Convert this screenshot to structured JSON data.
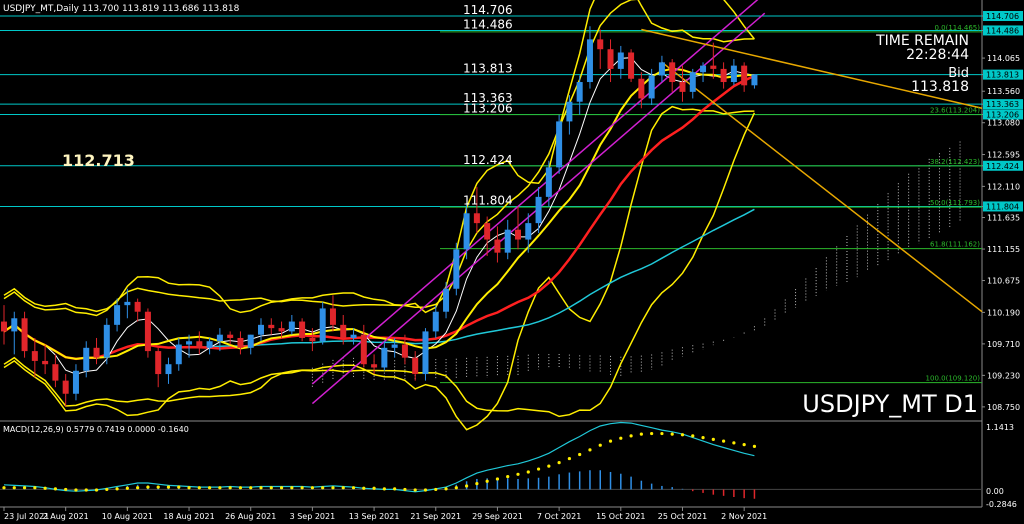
{
  "header": {
    "info": "USDJPY_MT,Daily  113.700 113.819 113.686 113.818"
  },
  "timer": {
    "title": "TIME REMAIN",
    "value": "22:28:44",
    "bid_label": "Bid",
    "bid_value": "113.818"
  },
  "watermark": "USDJPY_MT D1",
  "left_label": "112.713",
  "macd": {
    "label": "MACD(12,26,9) 0.5779 0.7419 0.0000 -0.1640",
    "scale": [
      "1.1413",
      "0.00",
      "-0.2846"
    ]
  },
  "colors": {
    "background": "#000000",
    "bull": "#2f8fe6",
    "bear": "#e0262b",
    "level": "#00c8c8",
    "fib": "#2bb82b",
    "ma_red": "#ff2020",
    "ma_yellow": "#ffee00",
    "ma_cyan": "#20c8d8",
    "channel": "#d020d0",
    "trend": "#e8a800"
  },
  "chart_data": {
    "type": "candlestick",
    "symbol": "USDJPY_MT",
    "timeframe": "D1",
    "y_range": [
      108.55,
      114.95
    ],
    "grid": false,
    "x_ticks": [
      {
        "index": 0,
        "label": "23 Jul 2021"
      },
      {
        "index": 6,
        "label": "2 Aug 2021"
      },
      {
        "index": 12,
        "label": "10 Aug 2021"
      },
      {
        "index": 18,
        "label": "18 Aug 2021"
      },
      {
        "index": 24,
        "label": "26 Aug 2021"
      },
      {
        "index": 30,
        "label": "3 Sep 2021"
      },
      {
        "index": 36,
        "label": "13 Sep 2021"
      },
      {
        "index": 42,
        "label": "21 Sep 2021"
      },
      {
        "index": 48,
        "label": "29 Sep 2021"
      },
      {
        "index": 54,
        "label": "7 Oct 2021"
      },
      {
        "index": 60,
        "label": "15 Oct 2021"
      },
      {
        "index": 66,
        "label": "25 Oct 2021"
      },
      {
        "index": 72,
        "label": "2 Nov 2021"
      }
    ],
    "y_ticks": [
      "114.706",
      "114.486",
      "114.065",
      "113.813",
      "113.560",
      "113.363",
      "113.206",
      "113.080",
      "112.595",
      "112.424",
      "112.110",
      "111.804",
      "111.635",
      "111.155",
      "110.675",
      "110.190",
      "109.710",
      "109.230",
      "108.750"
    ],
    "price_highlights": [
      {
        "value": 114.706,
        "label": "114.706"
      },
      {
        "value": 114.486,
        "label": "114.486"
      },
      {
        "value": 113.813,
        "label": "113.813"
      },
      {
        "value": 113.363,
        "label": "113.363"
      },
      {
        "value": 113.206,
        "label": "113.206"
      },
      {
        "value": 112.424,
        "label": "112.424"
      },
      {
        "value": 111.804,
        "label": "111.804"
      }
    ],
    "horizontal_levels": [
      {
        "value": 114.706,
        "label": "114.706"
      },
      {
        "value": 114.486,
        "label": "114.486"
      },
      {
        "value": 113.813,
        "label": "113.813"
      },
      {
        "value": 113.363,
        "label": "113.363"
      },
      {
        "value": 113.206,
        "label": "113.206"
      },
      {
        "value": 112.424,
        "label": "112.424"
      },
      {
        "value": 111.804,
        "label": "111.804"
      }
    ],
    "fib_levels": [
      {
        "value": 114.465,
        "label": "0.0(114.465)"
      },
      {
        "value": 113.204,
        "label": "23.6(113.204)"
      },
      {
        "value": 112.423,
        "label": "38.2(112.423)"
      },
      {
        "value": 111.793,
        "label": "50.0(111.793)"
      },
      {
        "value": 111.162,
        "label": "61.8(111.162)"
      },
      {
        "value": 109.12,
        "label": "100.0(109.120)"
      }
    ],
    "candles": [
      [
        110.05,
        110.3,
        109.7,
        109.9
      ],
      [
        109.9,
        110.2,
        109.55,
        110.1
      ],
      [
        110.1,
        110.2,
        109.5,
        109.6
      ],
      [
        109.6,
        109.8,
        109.2,
        109.45
      ],
      [
        109.45,
        109.7,
        109.25,
        109.4
      ],
      [
        109.4,
        109.55,
        109.05,
        109.15
      ],
      [
        109.15,
        109.25,
        108.75,
        108.95
      ],
      [
        108.95,
        109.4,
        108.85,
        109.3
      ],
      [
        109.3,
        109.75,
        109.2,
        109.65
      ],
      [
        109.65,
        109.8,
        109.4,
        109.5
      ],
      [
        109.5,
        110.1,
        109.4,
        110.0
      ],
      [
        110.0,
        110.4,
        109.9,
        110.3
      ],
      [
        110.3,
        110.55,
        110.1,
        110.35
      ],
      [
        110.35,
        110.4,
        110.05,
        110.2
      ],
      [
        110.2,
        110.25,
        109.5,
        109.6
      ],
      [
        109.6,
        109.65,
        109.05,
        109.25
      ],
      [
        109.25,
        109.5,
        109.1,
        109.4
      ],
      [
        109.4,
        109.8,
        109.3,
        109.7
      ],
      [
        109.7,
        109.85,
        109.5,
        109.75
      ],
      [
        109.75,
        109.9,
        109.55,
        109.65
      ],
      [
        109.65,
        109.8,
        109.55,
        109.75
      ],
      [
        109.75,
        109.95,
        109.6,
        109.85
      ],
      [
        109.85,
        109.9,
        109.7,
        109.8
      ],
      [
        109.8,
        109.9,
        109.55,
        109.65
      ],
      [
        109.65,
        109.85,
        109.55,
        109.85
      ],
      [
        109.85,
        110.1,
        109.75,
        110.0
      ],
      [
        110.0,
        110.1,
        109.85,
        109.95
      ],
      [
        109.95,
        110.05,
        109.8,
        109.9
      ],
      [
        109.9,
        110.15,
        109.85,
        110.05
      ],
      [
        110.05,
        110.1,
        109.75,
        109.8
      ],
      [
        109.8,
        109.95,
        109.6,
        109.75
      ],
      [
        109.75,
        110.35,
        109.7,
        110.25
      ],
      [
        110.25,
        110.45,
        109.9,
        110.0
      ],
      [
        110.0,
        110.15,
        109.7,
        109.8
      ],
      [
        109.8,
        109.95,
        109.7,
        109.85
      ],
      [
        109.85,
        110.0,
        109.35,
        109.4
      ],
      [
        109.4,
        109.55,
        109.25,
        109.35
      ],
      [
        109.35,
        109.75,
        109.3,
        109.65
      ],
      [
        109.65,
        109.8,
        109.5,
        109.7
      ],
      [
        109.7,
        109.85,
        109.4,
        109.5
      ],
      [
        109.5,
        109.6,
        109.15,
        109.25
      ],
      [
        109.25,
        109.95,
        109.15,
        109.9
      ],
      [
        109.9,
        110.3,
        109.8,
        110.2
      ],
      [
        110.2,
        110.65,
        110.1,
        110.55
      ],
      [
        110.55,
        111.25,
        110.45,
        111.15
      ],
      [
        111.15,
        111.85,
        111.0,
        111.7
      ],
      [
        111.7,
        112.1,
        111.4,
        111.55
      ],
      [
        111.55,
        111.65,
        111.05,
        111.3
      ],
      [
        111.3,
        111.5,
        110.95,
        111.1
      ],
      [
        111.1,
        111.6,
        111.0,
        111.45
      ],
      [
        111.45,
        111.8,
        111.15,
        111.3
      ],
      [
        111.3,
        111.7,
        111.1,
        111.55
      ],
      [
        111.55,
        112.1,
        111.4,
        111.95
      ],
      [
        111.95,
        112.5,
        111.8,
        112.4
      ],
      [
        112.4,
        113.2,
        112.3,
        113.1
      ],
      [
        113.1,
        113.5,
        112.9,
        113.4
      ],
      [
        113.4,
        113.8,
        113.2,
        113.7
      ],
      [
        113.7,
        114.55,
        113.6,
        114.35
      ],
      [
        114.35,
        114.5,
        113.9,
        114.2
      ],
      [
        114.2,
        114.35,
        113.7,
        113.9
      ],
      [
        113.9,
        114.25,
        113.75,
        114.15
      ],
      [
        114.15,
        114.2,
        113.7,
        113.75
      ],
      [
        113.75,
        113.85,
        113.3,
        113.45
      ],
      [
        113.45,
        113.9,
        113.35,
        113.8
      ],
      [
        113.8,
        114.1,
        113.7,
        114.0
      ],
      [
        114.0,
        114.05,
        113.55,
        113.7
      ],
      [
        113.7,
        113.95,
        113.4,
        113.55
      ],
      [
        113.55,
        113.9,
        113.45,
        113.85
      ],
      [
        113.85,
        114.0,
        113.7,
        113.95
      ],
      [
        113.95,
        114.3,
        113.75,
        113.9
      ],
      [
        113.9,
        114.0,
        113.6,
        113.7
      ],
      [
        113.7,
        114.05,
        113.65,
        113.95
      ],
      [
        113.95,
        114.0,
        113.55,
        113.65
      ],
      [
        113.65,
        113.82,
        113.6,
        113.818
      ]
    ],
    "macd_histogram": [
      0.05,
      0.04,
      0.03,
      0.02,
      0.01,
      -0.01,
      -0.02,
      -0.02,
      -0.01,
      0.0,
      0.02,
      0.04,
      0.06,
      0.08,
      0.07,
      0.05,
      0.03,
      0.02,
      0.02,
      0.01,
      0.01,
      0.01,
      0.02,
      0.01,
      0.01,
      0.02,
      0.02,
      0.02,
      0.02,
      0.02,
      0.01,
      0.02,
      0.03,
      0.02,
      0.01,
      0.0,
      -0.01,
      -0.01,
      -0.01,
      -0.02,
      -0.03,
      -0.01,
      0.01,
      0.03,
      0.08,
      0.14,
      0.18,
      0.19,
      0.19,
      0.19,
      0.18,
      0.19,
      0.2,
      0.22,
      0.26,
      0.29,
      0.31,
      0.33,
      0.33,
      0.3,
      0.27,
      0.22,
      0.15,
      0.1,
      0.06,
      0.04,
      0.01,
      -0.03,
      -0.06,
      -0.09,
      -0.11,
      -0.13,
      -0.15,
      -0.16
    ],
    "macd_signal": [
      0.03,
      0.03,
      0.03,
      0.03,
      0.02,
      0.01,
      0.0,
      -0.01,
      -0.01,
      -0.01,
      0.0,
      0.01,
      0.02,
      0.03,
      0.04,
      0.04,
      0.04,
      0.04,
      0.03,
      0.03,
      0.03,
      0.03,
      0.03,
      0.03,
      0.03,
      0.03,
      0.03,
      0.03,
      0.03,
      0.03,
      0.03,
      0.03,
      0.03,
      0.03,
      0.03,
      0.02,
      0.02,
      0.01,
      0.01,
      0.0,
      -0.01,
      -0.01,
      0.0,
      0.01,
      0.03,
      0.06,
      0.1,
      0.14,
      0.18,
      0.22,
      0.26,
      0.3,
      0.35,
      0.4,
      0.46,
      0.53,
      0.6,
      0.68,
      0.76,
      0.83,
      0.88,
      0.92,
      0.95,
      0.96,
      0.96,
      0.95,
      0.94,
      0.92,
      0.89,
      0.86,
      0.83,
      0.8,
      0.77,
      0.74
    ]
  }
}
